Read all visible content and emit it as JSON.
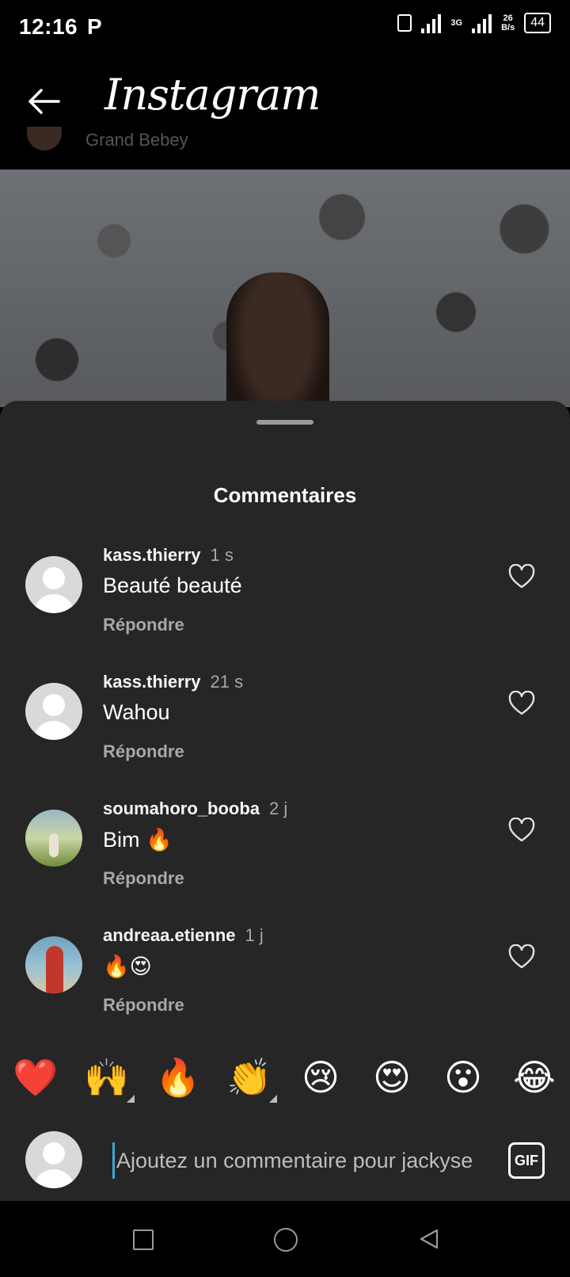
{
  "status_bar": {
    "time": "12:16",
    "app_indicator": "P",
    "network_type": "3G",
    "speed_value": "26",
    "speed_unit": "B/s",
    "battery": "44"
  },
  "header": {
    "back_icon": "arrow-left-icon",
    "title": "Instagram",
    "partial_username": "Grand Bebey"
  },
  "sheet": {
    "title": "Commentaires",
    "comments": [
      {
        "username": "kass.thierry",
        "time": "1 s",
        "text": "Beauté beauté",
        "reply": "Répondre",
        "avatar": "default"
      },
      {
        "username": "kass.thierry",
        "time": "21 s",
        "text": "Wahou",
        "reply": "Répondre",
        "avatar": "default"
      },
      {
        "username": "soumahoro_booba",
        "time": "2 j",
        "text": "Bim 🔥",
        "reply": "Répondre",
        "avatar": "photo"
      },
      {
        "username": "andreaa.etienne",
        "time": "1 j",
        "text": "🔥😍",
        "reply": "Répondre",
        "avatar": "photo"
      }
    ],
    "emojis": [
      "❤️",
      "🙌",
      "🔥",
      "👏",
      "😢",
      "😍",
      "😮",
      "😂"
    ],
    "input": {
      "placeholder": "Ajoutez un commentaire pour jackyse",
      "gif_label": "GIF"
    }
  },
  "colors": {
    "sheet_bg": "#262626",
    "secondary_text": "#a8a8a8",
    "cursor": "#3ea6d8"
  }
}
